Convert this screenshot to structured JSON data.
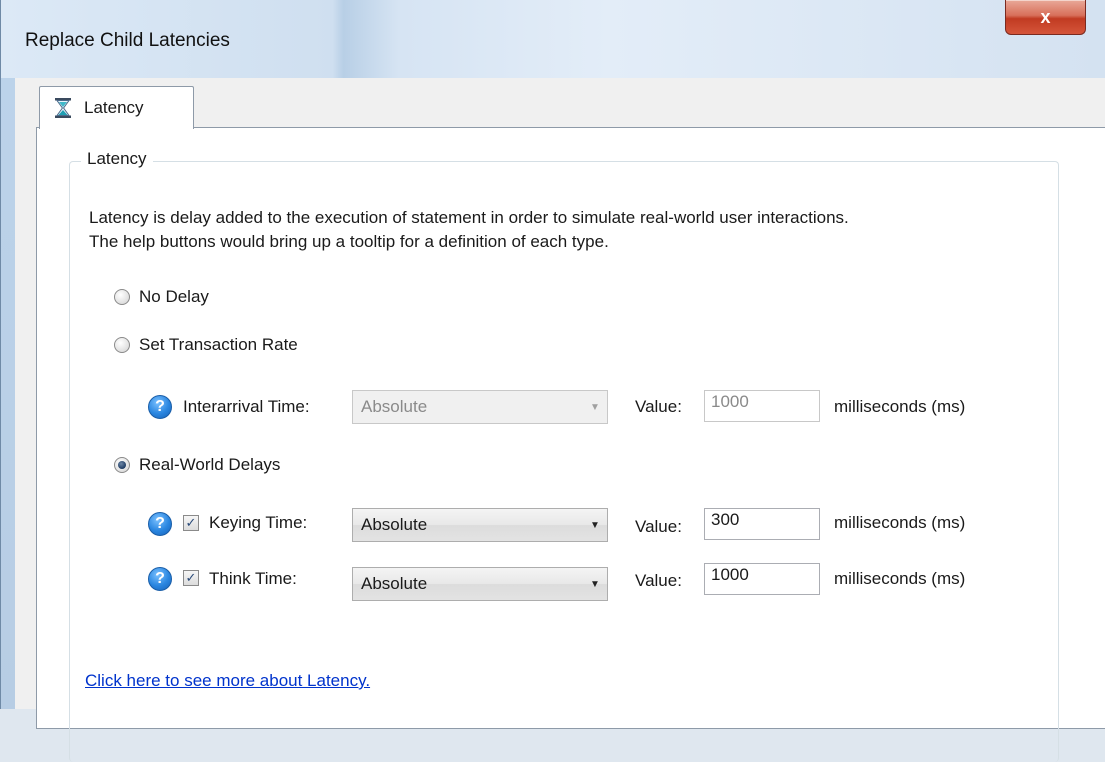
{
  "window": {
    "title": "Replace Child Latencies",
    "close_glyph": "x"
  },
  "tab": {
    "label": "Latency",
    "icon": "hourglass-icon"
  },
  "group": {
    "legend": "Latency",
    "description_line1": "Latency is delay added to the execution of statement in order to simulate real-world user interactions.",
    "description_line2": "The help buttons would bring up a tooltip for a definition of each type."
  },
  "options": {
    "no_delay": {
      "label": "No Delay",
      "selected": false
    },
    "transaction_rate": {
      "label": "Set Transaction Rate",
      "selected": false
    },
    "real_world": {
      "label": "Real-World Delays",
      "selected": true
    }
  },
  "interarrival": {
    "label": "Interarrival Time:",
    "mode": "Absolute",
    "value_label": "Value:",
    "value": "1000",
    "unit": "milliseconds (ms)",
    "enabled": false
  },
  "keying": {
    "label": "Keying Time:",
    "checked": true,
    "mode": "Absolute",
    "value_label": "Value:",
    "value": "300",
    "unit": "milliseconds (ms)"
  },
  "think": {
    "label": "Think Time:",
    "checked": true,
    "mode": "Absolute",
    "value_label": "Value:",
    "value": "1000",
    "unit": "milliseconds (ms)"
  },
  "help_glyph": "?",
  "check_glyph": "✓",
  "link_text": "Click here to see more about Latency."
}
